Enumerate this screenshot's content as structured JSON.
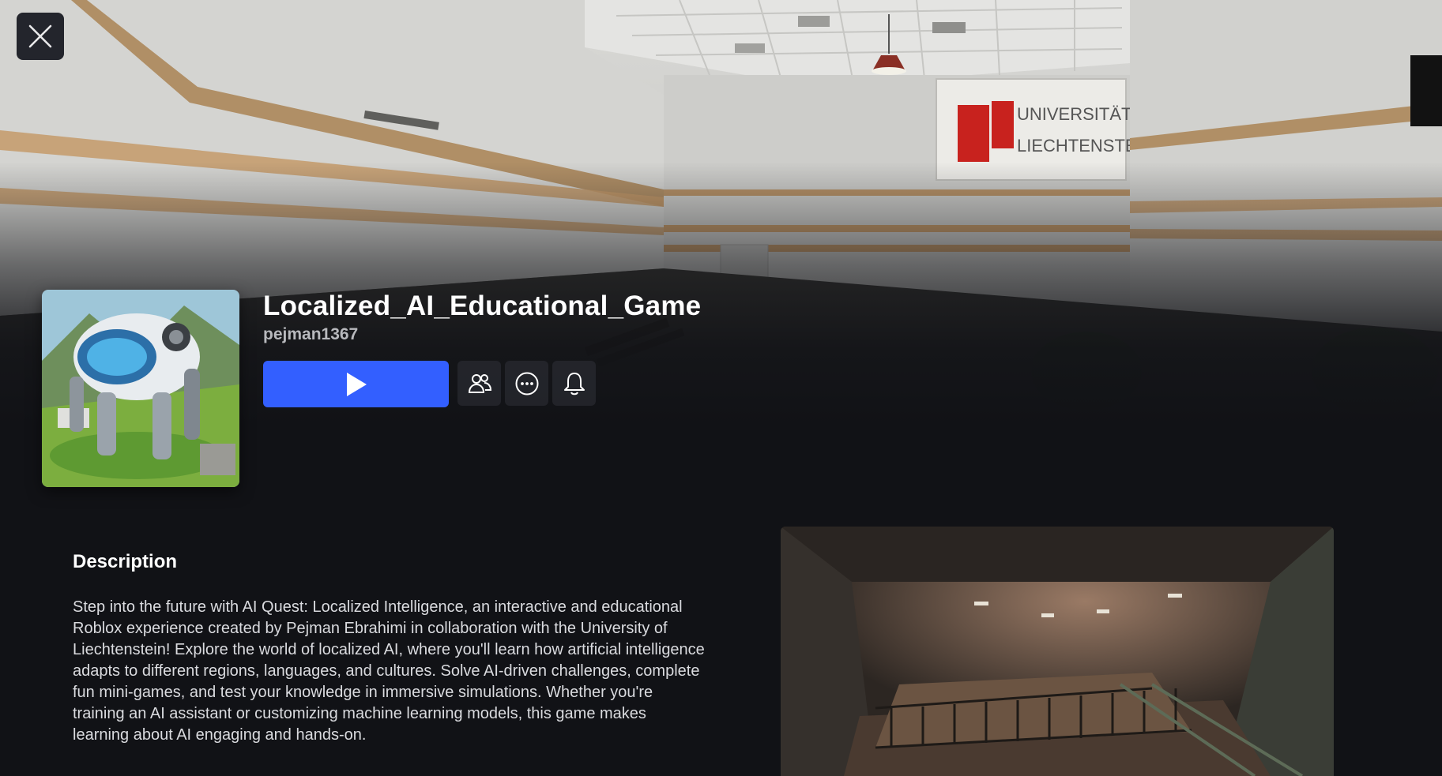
{
  "close_button": {
    "icon": "close-icon"
  },
  "game": {
    "title": "Localized_AI_Educational_Game",
    "creator": "pejman1367",
    "play_button": {
      "icon": "play-icon"
    },
    "actions": [
      {
        "name": "friends-button",
        "icon": "friends-icon"
      },
      {
        "name": "more-options-button",
        "icon": "more-icon"
      },
      {
        "name": "notify-button",
        "icon": "bell-icon"
      }
    ]
  },
  "hero_sign": {
    "line1": "UNIVERSITÄT",
    "line2": "LIECHTENSTEIN"
  },
  "description": {
    "heading": "Description",
    "text": "Step into the future with AI Quest: Localized Intelligence, an interactive and educational Roblox experience created by Pejman Ebrahimi in collaboration with the University of Liechtenstein! Explore the world of localized AI, where you'll learn how artificial intelligence adapts to different regions, languages, and cultures. Solve AI-driven challenges, complete fun mini-games, and test your knowledge in immersive simulations. Whether you're training an AI assistant or customizing machine learning models, this game makes learning about AI engaging and hands-on."
  },
  "colors": {
    "background": "#111216",
    "play_button": "#335fff",
    "icon_button": "#282a30",
    "creator_text": "#b8b9bd"
  }
}
